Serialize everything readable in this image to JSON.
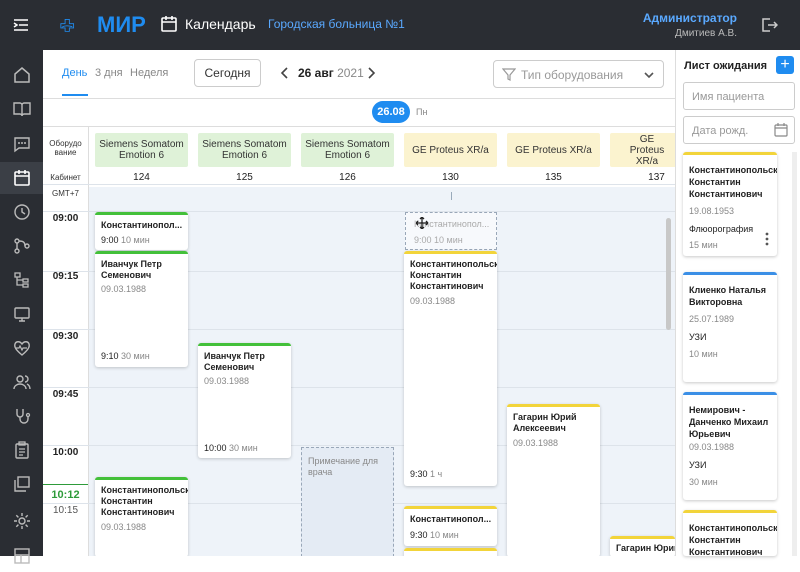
{
  "header": {
    "logo_text": "МИР",
    "page_title": "Календарь",
    "hospital": "Городская больница №1",
    "user_role": "Администратор",
    "user_name": "Дмитиев А.В."
  },
  "toolbar": {
    "tabs": [
      {
        "label": "День",
        "active": true
      },
      {
        "label": "3 дня",
        "active": false
      },
      {
        "label": "Неделя",
        "active": false
      }
    ],
    "today_label": "Сегодня",
    "date": "26 авг",
    "year": "2021",
    "equipment_placeholder": "Тип оборудования"
  },
  "day": {
    "badge": "26.08",
    "weekday": "Пн"
  },
  "grid": {
    "equipment_header": "Оборудо вание",
    "room_header": "Кабинет",
    "timezone": "GMT+7",
    "columns": [
      {
        "equipment": "Siemens Somatom Emotion 6",
        "room": "124",
        "color": "green"
      },
      {
        "equipment": "Siemens Somatom Emotion 6",
        "room": "125",
        "color": "green"
      },
      {
        "equipment": "Siemens Somatom Emotion 6",
        "room": "126",
        "color": "green"
      },
      {
        "equipment": "GE Proteus XR/a",
        "room": "130",
        "color": "yellow"
      },
      {
        "equipment": "GE Proteus XR/a",
        "room": "135",
        "color": "yellow"
      },
      {
        "equipment": "GE Proteus XR/a",
        "room": "137",
        "color": "yellow"
      }
    ],
    "times": [
      "09:00",
      "09:15",
      "09:30",
      "09:45",
      "10:00",
      "10:15"
    ],
    "current_time": "10:12"
  },
  "appointments": [
    {
      "name": "Константинопол...",
      "dob": "",
      "time": "9:00",
      "duration": "10 мин"
    },
    {
      "name": "Иванчук Петр Семенович",
      "dob": "09.03.1988",
      "time": "9:10",
      "duration": "30 мин"
    },
    {
      "name": "Иванчук Петр Семенович",
      "dob": "09.03.1988",
      "time": "10:00",
      "duration": "30 мин"
    },
    {
      "name": "Константинопольский Константин Константинович",
      "dob": "09.03.1988",
      "time": "9:30",
      "duration": "1 ч"
    },
    {
      "name": "Константинопол...",
      "dob": "",
      "time": "9:30",
      "duration": "10 мин"
    },
    {
      "name": "Гагарин Юрий Алексеевич",
      "dob": "09.03.1988",
      "time": "",
      "duration": ""
    },
    {
      "name": "Константинопольский Константин Константинович",
      "dob": "09.03.1988",
      "time": "",
      "duration": ""
    },
    {
      "name": "Гагарин Юрий Алексеевич",
      "dob": "",
      "time": "",
      "duration": ""
    }
  ],
  "ghost_appointment": {
    "name": "Константинопол...",
    "time": "9:00",
    "duration": "10 мин"
  },
  "doctor_note": "Примечание для врача",
  "waiting_list": {
    "title": "Лист ожидания",
    "name_placeholder": "Имя пациента",
    "dob_placeholder": "Дата рожд.",
    "cards": [
      {
        "name": "Константинопольский Константин Константинович",
        "dob": "19.08.1953",
        "type": "Флюорография",
        "duration": "15 мин",
        "color": "yellow"
      },
      {
        "name": "Клиенко Наталья Викторовна",
        "dob": "25.07.1989",
        "type": "УЗИ",
        "duration": "10 мин",
        "color": "blue"
      },
      {
        "name": "Немирович - Данченко Михаил Юрьевич",
        "dob": "09.03.1988",
        "type": "УЗИ",
        "duration": "30 мин",
        "color": "blue"
      },
      {
        "name": "Константинопольский Константин Константинович",
        "dob": "",
        "type": "",
        "duration": "",
        "color": "yellow"
      }
    ]
  },
  "colors": {
    "accent": "#1f8cf0",
    "topbar": "#2a2d33",
    "now": "#2e9b3a"
  }
}
